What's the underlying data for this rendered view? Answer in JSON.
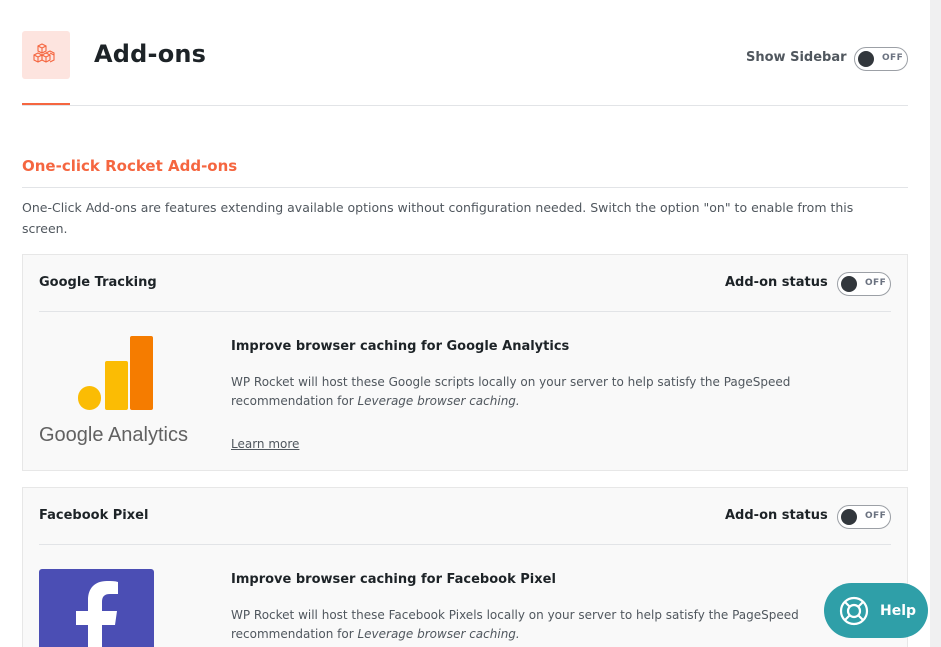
{
  "header": {
    "title": "Add-ons",
    "icon": "cubes-icon",
    "show_sidebar_label": "Show Sidebar",
    "show_sidebar_state": "OFF"
  },
  "section": {
    "title": "One-click Rocket Add-ons",
    "description": "One-Click Add-ons are features extending available options without configuration needed. Switch the option \"on\" to enable from this screen."
  },
  "addons": [
    {
      "name": "Google Tracking",
      "status_label": "Add-on status",
      "status": "OFF",
      "logo_text": "Google Analytics",
      "title": "Improve browser caching for Google Analytics",
      "text": "WP Rocket will host these Google scripts locally on your server to help satisfy the PageSpeed recommendation for",
      "text_em": "Leverage browser caching.",
      "link": "Learn more"
    },
    {
      "name": "Facebook Pixel",
      "status_label": "Add-on status",
      "status": "OFF",
      "title": "Improve browser caching for Facebook Pixel",
      "text": "WP Rocket will host these Facebook Pixels locally on your server to help satisfy the PageSpeed recommendation for",
      "text_em": "Leverage browser caching."
    }
  ],
  "help": {
    "label": "Help",
    "icon": "lifebuoy-icon"
  },
  "colors": {
    "accent": "#f56640",
    "help": "#2f9fa8",
    "ga_orange": "#f57c00",
    "ga_yellow": "#fbbc04",
    "fb_blue": "#4b4eb4"
  }
}
